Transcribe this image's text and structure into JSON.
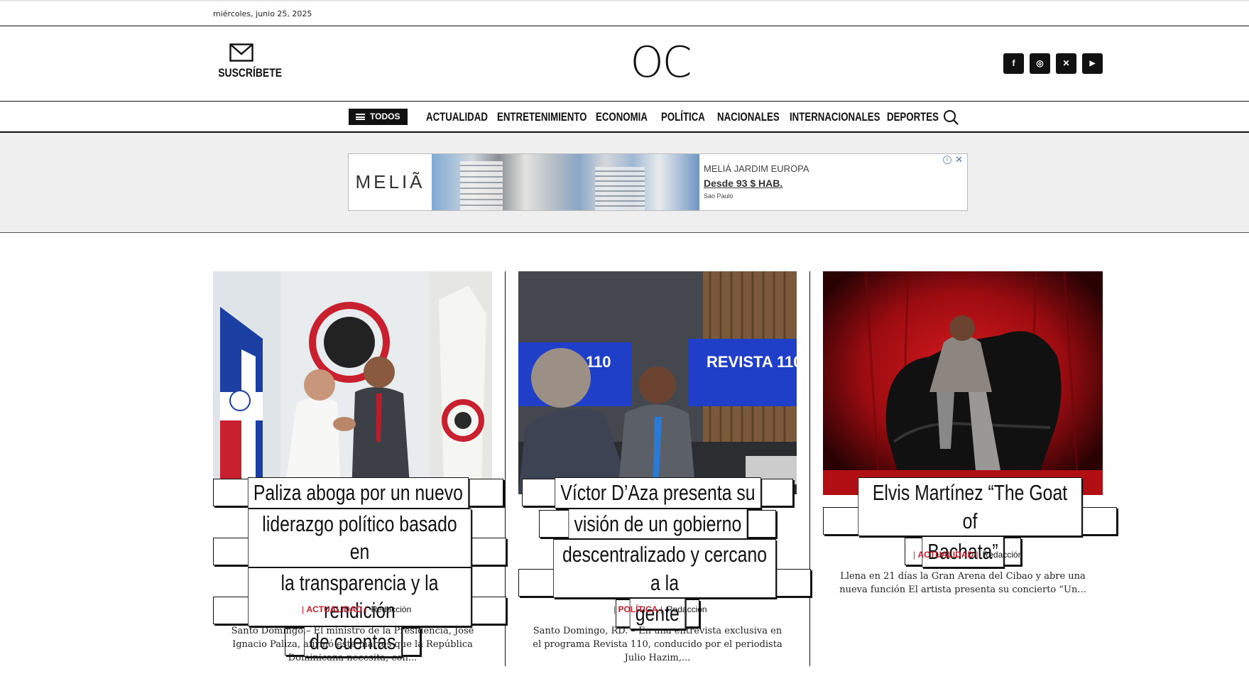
{
  "top_bar": {
    "date": "miércoles, junio 25, 2025"
  },
  "header": {
    "subscribe_label": "SUSCRÍBETE",
    "logo": "OC",
    "social": [
      {
        "name": "facebook-icon",
        "glyph": "f"
      },
      {
        "name": "instagram-icon",
        "glyph": "◎"
      },
      {
        "name": "x-twitter-icon",
        "glyph": "✕"
      },
      {
        "name": "youtube-icon",
        "glyph": "▶"
      }
    ]
  },
  "nav": {
    "all_label": "TODOS",
    "items": [
      "ACTUALIDAD",
      "ENTRETENIMIENTO",
      "ECONOMIA",
      "POLÍTICA",
      "NACIONALES",
      "INTERNACIONALES",
      "DEPORTES"
    ]
  },
  "ad": {
    "brand": "MELIÃ",
    "headline": "MELIÁ JARDIM EUROPA",
    "cta": "Desde 93 $ HAB.",
    "location": "Sao Paulo",
    "info": "i",
    "close": "✕"
  },
  "articles": [
    {
      "title": "Paliza aboga por un nuevo liderazgo político basado en la transparencia y la rendición de cuentas",
      "title_lines": [
        "Paliza aboga por un nuevo",
        "liderazgo político basado en",
        "la transparencia y la rendición",
        "de cuentas"
      ],
      "category": "ACTUALIDAD",
      "author": "Redacción",
      "excerpt": "Santo Domingo.– El ministro de la Presidencia, José Ignacio Paliza, afirmó este martes que la República Dominicana necesita, con..."
    },
    {
      "title": "Víctor D’Aza presenta su visión de un gobierno descentralizado y cercano a la gente",
      "title_lines": [
        "Víctor D’Aza presenta su",
        "visión de un gobierno",
        "descentralizado y cercano a la",
        "gente"
      ],
      "category": "POLÍTICA",
      "author": "Redacción",
      "excerpt": "Santo Domingo, RD. – En una entrevista exclusiva en el programa Revista 110, conducido por el periodista Julio Hazim,..."
    },
    {
      "title": "Elvis Martínez “The Goat of Bachata”",
      "title_lines": [
        "Elvis Martínez “The Goat of",
        "Bachata”"
      ],
      "category": "ACTUALIDAD",
      "author": "Redacción",
      "excerpt": "Llena en 21 días la Gran Arena del Cibao y abre una nueva función El artista presenta su concierto “Un..."
    }
  ],
  "colors": {
    "accent": "#c8202f",
    "text": "#111111",
    "ad_bg": "#efefef"
  }
}
